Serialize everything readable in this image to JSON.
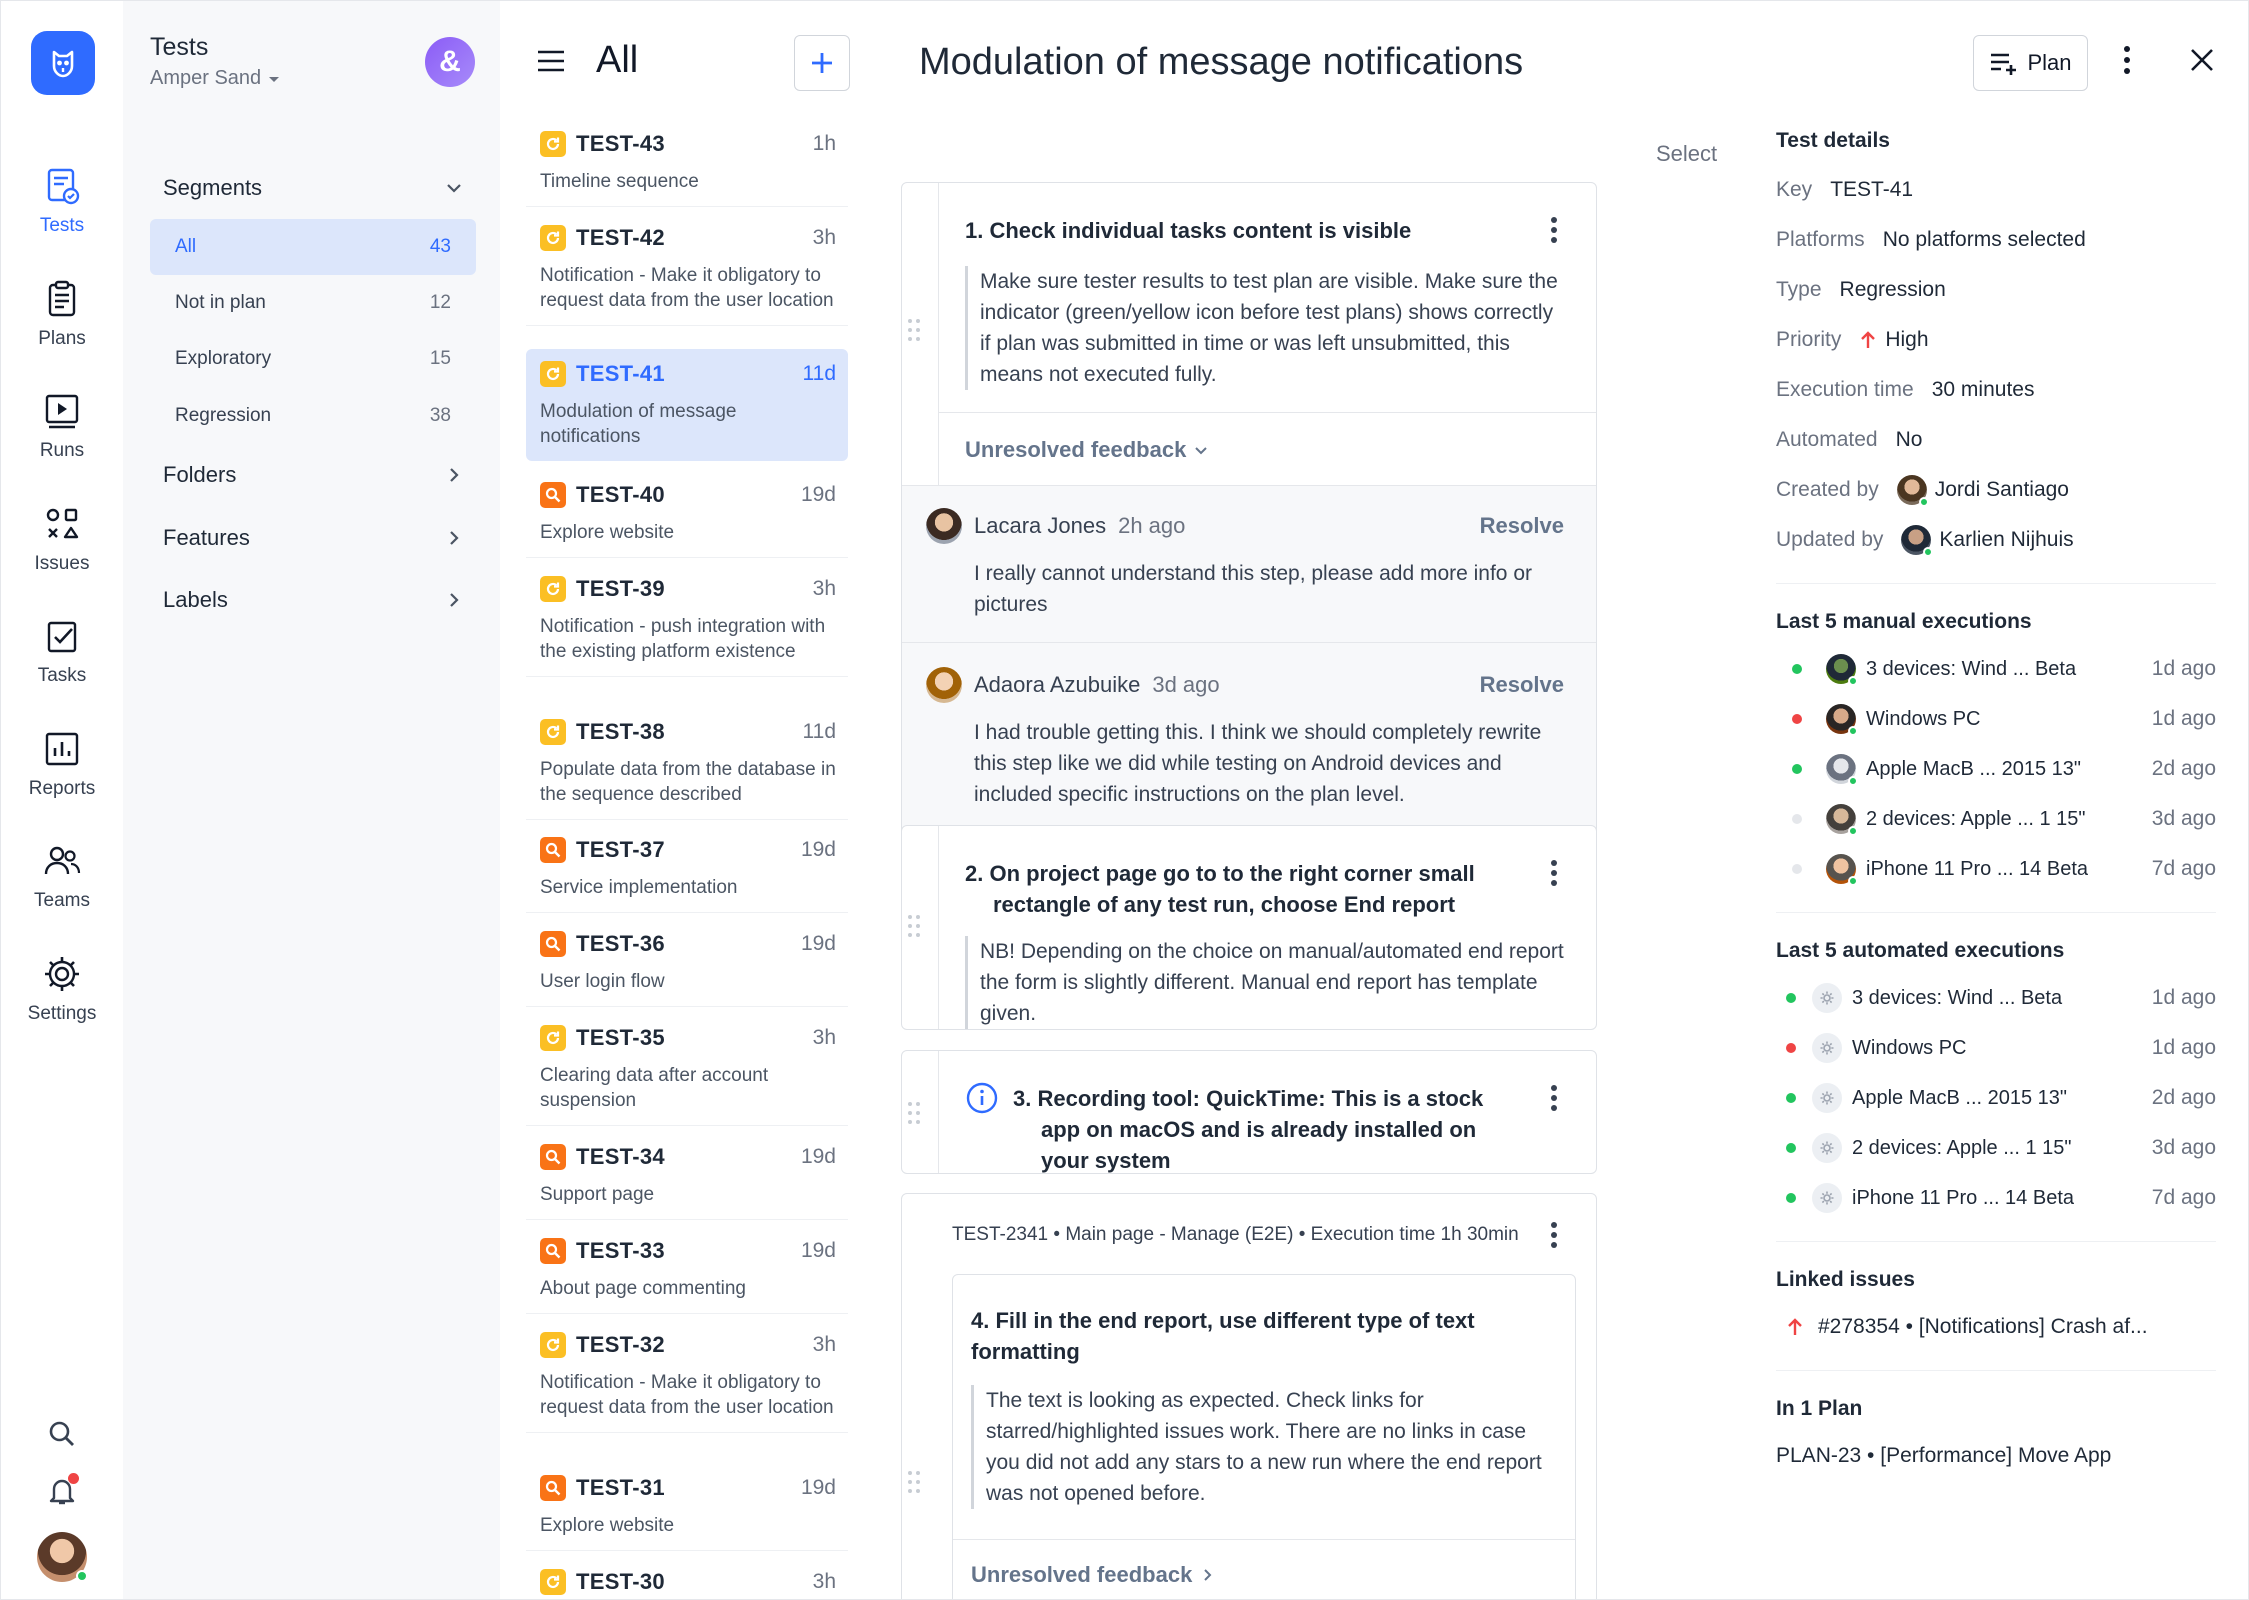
{
  "rail": {
    "items": [
      {
        "label": "Tests",
        "icon": "tests-icon",
        "active": true
      },
      {
        "label": "Plans",
        "icon": "plans-icon"
      },
      {
        "label": "Runs",
        "icon": "runs-icon"
      },
      {
        "label": "Issues",
        "icon": "issues-icon"
      },
      {
        "label": "Tasks",
        "icon": "tasks-icon"
      },
      {
        "label": "Reports",
        "icon": "reports-icon"
      },
      {
        "label": "Teams",
        "icon": "teams-icon"
      },
      {
        "label": "Settings",
        "icon": "settings-icon"
      }
    ]
  },
  "project": {
    "title": "Tests",
    "workspace": "Amper Sand",
    "avatar_letter": "&"
  },
  "segments": {
    "heading": "Segments",
    "items": [
      {
        "label": "All",
        "count": "43",
        "active": true
      },
      {
        "label": "Not in plan",
        "count": "12"
      },
      {
        "label": "Exploratory",
        "count": "15"
      },
      {
        "label": "Regression",
        "count": "38"
      }
    ],
    "folders": "Folders",
    "features": "Features",
    "labels": "Labels"
  },
  "list": {
    "title": "All",
    "tests": [
      {
        "key": "TEST-43",
        "age": "1h",
        "desc": "Timeline sequence",
        "kind": "regression"
      },
      {
        "key": "TEST-42",
        "age": "3h",
        "desc": "Notification - Make it obligatory to request data from the user location",
        "kind": "regression"
      },
      {
        "key": "TEST-41",
        "age": "11d",
        "desc": "Modulation of message notifications",
        "kind": "regression",
        "active": true
      },
      {
        "key": "TEST-40",
        "age": "19d",
        "desc": "Explore website",
        "kind": "exploratory"
      },
      {
        "key": "TEST-39",
        "age": "3h",
        "desc": "Notification - push integration with the existing platform existence",
        "kind": "regression"
      },
      {
        "key": "TEST-38",
        "age": "11d",
        "desc": "Populate data from the database in the sequence described",
        "kind": "regression"
      },
      {
        "key": "TEST-37",
        "age": "19d",
        "desc": "Service implementation",
        "kind": "exploratory"
      },
      {
        "key": "TEST-36",
        "age": "19d",
        "desc": "User login flow",
        "kind": "exploratory"
      },
      {
        "key": "TEST-35",
        "age": "3h",
        "desc": "Clearing data after account suspension",
        "kind": "regression"
      },
      {
        "key": "TEST-34",
        "age": "19d",
        "desc": "Support page",
        "kind": "exploratory"
      },
      {
        "key": "TEST-33",
        "age": "19d",
        "desc": "About page commenting",
        "kind": "exploratory"
      },
      {
        "key": "TEST-32",
        "age": "3h",
        "desc": "Notification - Make it obligatory to request data from the user location",
        "kind": "regression"
      },
      {
        "key": "TEST-31",
        "age": "19d",
        "desc": "Explore website",
        "kind": "exploratory"
      },
      {
        "key": "TEST-30",
        "age": "3h",
        "desc": "",
        "kind": "regression"
      }
    ]
  },
  "main": {
    "title": "Modulation of message notifications",
    "plan_button": "Plan",
    "select": "Select",
    "steps": [
      {
        "title": "1. Check individual tasks content is visible",
        "body": "Make sure tester results to test plan are visible. Make sure the indicator (green/yellow icon before test plans) shows correctly if plan was submitted in time or was left unsubmitted, this means not executed fully.",
        "feedback": "Unresolved feedback",
        "comments": [
          {
            "author": "Lacara Jones",
            "time": "2h ago",
            "resolve": "Resolve",
            "text": "I really cannot understand this step, please add more info or pictures"
          },
          {
            "author": "Adaora Azubuike",
            "time": "3d ago",
            "resolve": "Resolve",
            "text": "I had trouble getting this. I think we should completely rewrite this step like we did while testing on Android devices and included specific instructions on the plan level."
          }
        ]
      },
      {
        "title": "2. On project page go to to the right corner small rectangle of any test run, choose End report",
        "body": "NB! Depending on the choice on manual/automated end report the form is slightly different. Manual end report has template given."
      },
      {
        "title": "3. Recording tool: QuickTime: This is a stock app on macOS and is already installed on your system"
      },
      {
        "meta": "TEST-2341 • Main page - Manage (E2E) • Execution time 1h 30min",
        "title": "4. Fill in the end report, use different type of text formatting",
        "body": "The text is looking as expected. Check links for starred/highlighted issues work. There are no links in case you did not add any stars to a new run where the end report was not opened before.",
        "feedback": "Unresolved feedback"
      }
    ]
  },
  "details": {
    "title": "Test details",
    "key_label": "Key",
    "key": "TEST-41",
    "platforms_label": "Platforms",
    "platforms": "No platforms selected",
    "type_label": "Type",
    "type": "Regression",
    "priority_label": "Priority",
    "priority": "High",
    "exec_label": "Execution time",
    "exec": "30 minutes",
    "automated_label": "Automated",
    "automated": "No",
    "created_label": "Created by",
    "created": "Jordi Santiago",
    "updated_label": "Updated by",
    "updated": "Karlien Nijhuis",
    "manual_title": "Last 5 manual executions",
    "manual": [
      {
        "name": "3 devices: Wind ... Beta",
        "time": "1d ago",
        "status": "#22c55e"
      },
      {
        "name": "Windows PC",
        "time": "1d ago",
        "status": "#ef4444"
      },
      {
        "name": "Apple MacB ... 2015 13\"",
        "time": "2d ago",
        "status": "#22c55e"
      },
      {
        "name": "2 devices: Apple ... 1 15\"",
        "time": "3d ago",
        "status": "#e5e7eb"
      },
      {
        "name": "iPhone 11 Pro ... 14 Beta",
        "time": "7d ago",
        "status": "#e5e7eb"
      }
    ],
    "auto_title": "Last 5 automated executions",
    "auto": [
      {
        "name": "3 devices: Wind ... Beta",
        "time": "1d ago",
        "status": "#22c55e"
      },
      {
        "name": "Windows PC",
        "time": "1d ago",
        "status": "#ef4444"
      },
      {
        "name": "Apple MacB ... 2015 13\"",
        "time": "2d ago",
        "status": "#22c55e"
      },
      {
        "name": "2 devices: Apple ... 1 15\"",
        "time": "3d ago",
        "status": "#22c55e"
      },
      {
        "name": "iPhone 11 Pro ... 14 Beta",
        "time": "7d ago",
        "status": "#22c55e"
      }
    ],
    "linked_title": "Linked issues",
    "linked": "#278354 • [Notifications] Crash af...",
    "plan_title": "In 1 Plan",
    "plan": "PLAN-23 • [Performance] Move App"
  },
  "colors": {
    "accent": "#2f6bff",
    "regression": "#fbbf24",
    "exploratory": "#f97316",
    "selected_bg": "#dce6fb"
  }
}
